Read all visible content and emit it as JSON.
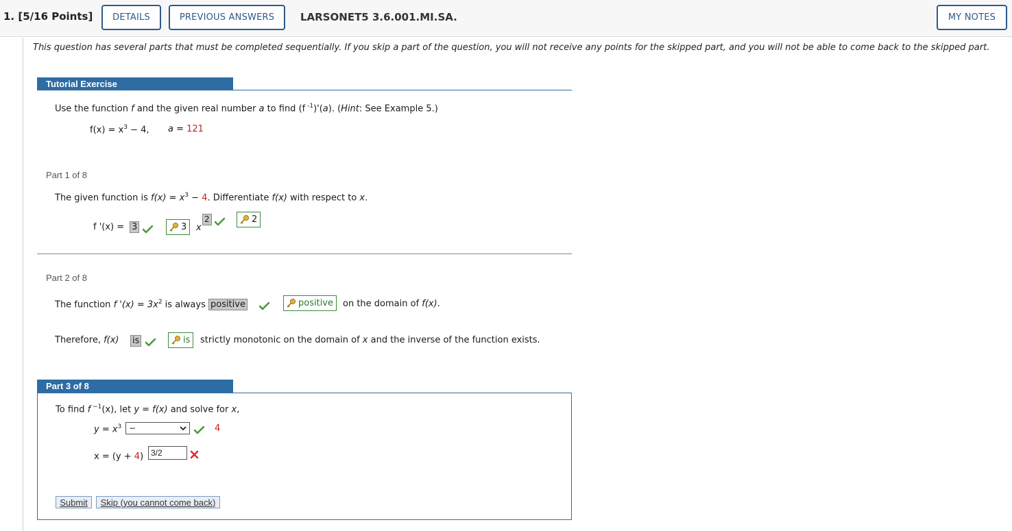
{
  "header": {
    "question_number": "1.  [5/16 Points]",
    "details_label": "DETAILS",
    "previous_answers_label": "PREVIOUS ANSWERS",
    "question_id": "LARSONET5 3.6.001.MI.SA.",
    "my_notes_label": "MY NOTES"
  },
  "intro": "This question has several parts that must be completed sequentially. If you skip a part of the question, you will not receive any points for the skipped part, and you will not be able to come back to the skipped part.",
  "tutorial": {
    "heading": "Tutorial Exercise",
    "prompt_a": "Use the function ",
    "prompt_f": "f",
    "prompt_b": " and the given real number ",
    "prompt_a_var": "a",
    "prompt_c": " to find (f",
    "prompt_sup": " -1",
    "prompt_d": ")'(",
    "prompt_e": "a",
    "prompt_g": "). (",
    "prompt_hint": "Hint",
    "prompt_h": ": See Example 5.)",
    "func_lhs": "f(x) = x",
    "func_exp": "3",
    "func_rest": " − 4,",
    "a_label": "a = ",
    "a_value": "121"
  },
  "part1": {
    "label": "Part 1 of 8",
    "text_a": "The given function is ",
    "text_fx": "f(x) = x",
    "text_exp": "3",
    "text_minus": " − ",
    "text_four": "4",
    "text_b": ". Differentiate ",
    "text_fx2": "f(x)",
    "text_c": " with respect to ",
    "text_x": "x",
    "text_d": ".",
    "deriv_label": "f '(x) = ",
    "coef_answer": "3",
    "coef_key": "3",
    "x_var": "x",
    "exp_answer": "2",
    "exp_key": "2"
  },
  "part2": {
    "label": "Part 2 of 8",
    "line1_a": "The function ",
    "line1_fp": "f '(x) = 3x",
    "line1_exp": "2",
    "line1_b": " is always ",
    "answer1": "positive",
    "key1": "positive",
    "line1_c": " on the domain of ",
    "line1_fx": "f(x)",
    "line1_d": ".",
    "line2_a": "Therefore, ",
    "line2_fx": "f(x)",
    "answer2": "is",
    "key2": "is",
    "line2_b": " strictly monotonic on the domain of ",
    "line2_x": "x",
    "line2_c": " and the inverse of the function exists."
  },
  "part3": {
    "label": "Part 3 of 8",
    "line1_a": "To find ",
    "line1_f": "f",
    "line1_sup": " −1",
    "line1_b": "(x),  let ",
    "line1_y": "y = f(x)",
    "line1_c": " and solve for ",
    "line1_x": "x",
    "line1_d": ",",
    "eq1_lhs": "y = x",
    "eq1_exp": "3",
    "select_value": "−",
    "eq1_const": "4",
    "eq2_lhs": "x = (y + ",
    "eq2_four": "4",
    "eq2_close": ")",
    "input_value": "3/2",
    "submit_label": "Submit",
    "skip_label": "Skip (you cannot come back)"
  },
  "colors": {
    "brand_blue": "#2e6ca4",
    "correct_green": "#4a9a3a",
    "wrong_red": "#d93030",
    "value_red": "#c81e1e"
  }
}
